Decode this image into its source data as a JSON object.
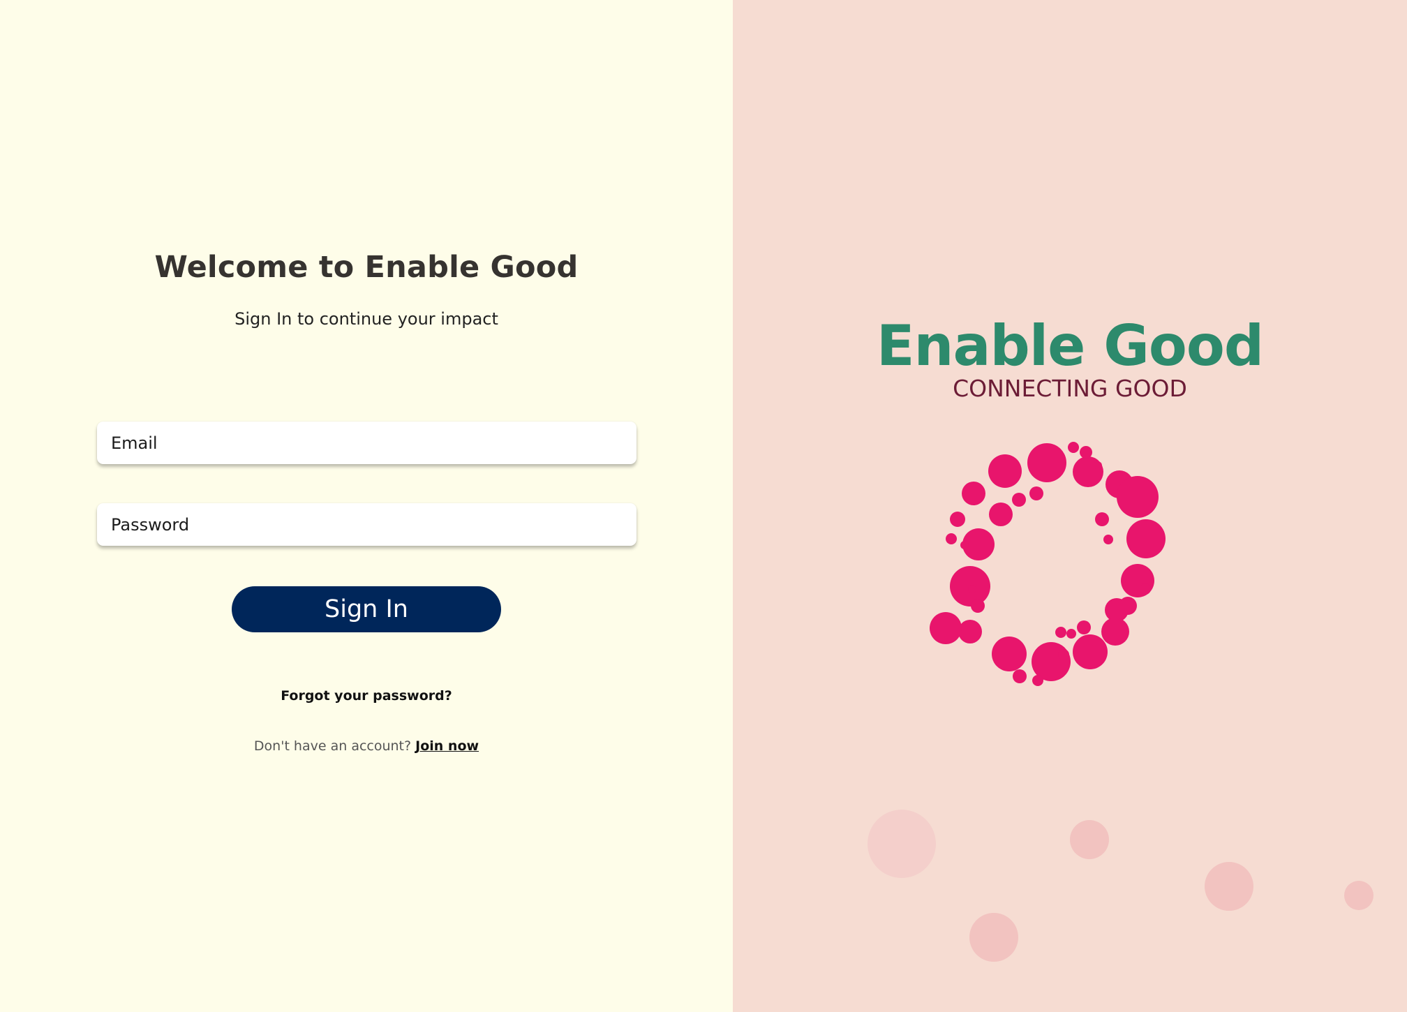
{
  "login": {
    "title": "Welcome to Enable Good",
    "subtitle": "Sign In to continue your impact",
    "email_placeholder": "Email",
    "password_placeholder": "Password",
    "signin_label": "Sign In",
    "forgot_label": "Forgot your password?",
    "no_account_label": "Don't have an account?",
    "join_label": "Join now"
  },
  "brand": {
    "name": "Enable Good",
    "tagline": "CONNECTING GOOD"
  },
  "colors": {
    "left_background": "#fefde9",
    "right_background": "#f6dcd2",
    "brand_green": "#2d8a6c",
    "tagline_maroon": "#6c1c36",
    "logo_pink": "#e8156c",
    "button_navy": "#00265a"
  },
  "icons": {
    "logo": "dotted-ring-logo-icon",
    "decoration": "decorative-bubbles"
  }
}
